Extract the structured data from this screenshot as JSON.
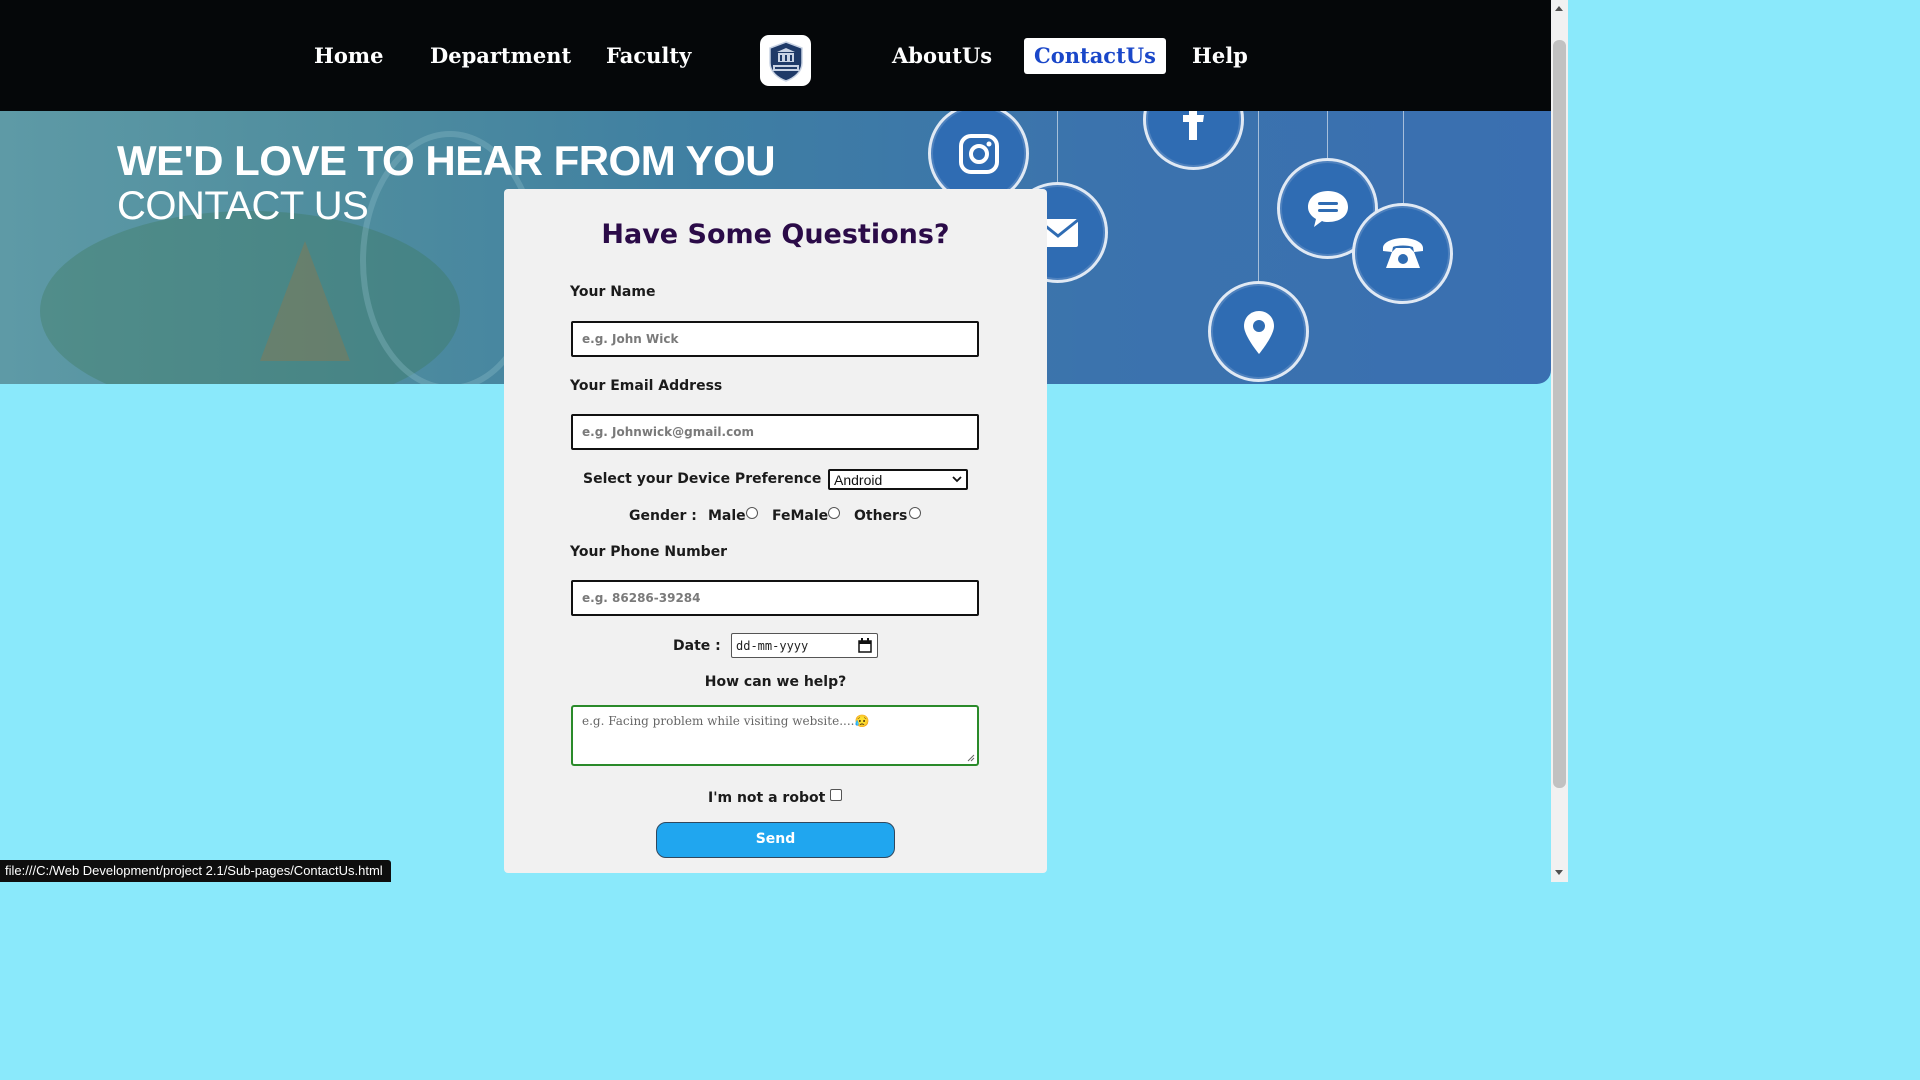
{
  "nav": {
    "items": [
      {
        "label": "Home"
      },
      {
        "label": "Department"
      },
      {
        "label": "Faculty"
      },
      {
        "label": "AboutUs"
      },
      {
        "label": "ContactUs",
        "active": true
      },
      {
        "label": "Help"
      }
    ],
    "logo_icon": "university-crest-icon",
    "active_color": "#1a47c9"
  },
  "hero": {
    "title": "WE'D LOVE TO HEAR FROM YOU",
    "subtitle": "CONTACT US",
    "icons": [
      "instagram-icon",
      "facebook-icon",
      "mail-icon",
      "chat-icon",
      "phone-icon",
      "location-icon"
    ]
  },
  "form": {
    "title": "Have Some Questions?",
    "name_label": "Your Name",
    "name_placeholder": "e.g. John Wick",
    "email_label": "Your Email Address",
    "email_placeholder": "e.g. Johnwick@gmail.com",
    "device_label": "Select your Device Preference",
    "device_value": "Android",
    "gender_label": "Gender  :",
    "gender_options": [
      "Male",
      "FeMale",
      "Others"
    ],
    "phone_label": "Your Phone Number",
    "phone_placeholder": "e.g. 86286-39284",
    "date_label": "Date  :",
    "date_placeholder": "dd-mm-yyyy",
    "help_label": "How can we help?",
    "help_placeholder": "e.g. Facing problem while visiting website....😥",
    "robot_label": "I'm not a robot",
    "send_label": "Send",
    "title_color": "#2b0b48",
    "send_color": "#20a6ef"
  },
  "status_bar": {
    "url": "file:///C:/Web Development/project 2.1/Sub-pages/ContactUs.html"
  },
  "colors": {
    "page_bg": "#8ae9fb",
    "nav_bg": "#050709",
    "card_bg": "#f1f1f1"
  }
}
